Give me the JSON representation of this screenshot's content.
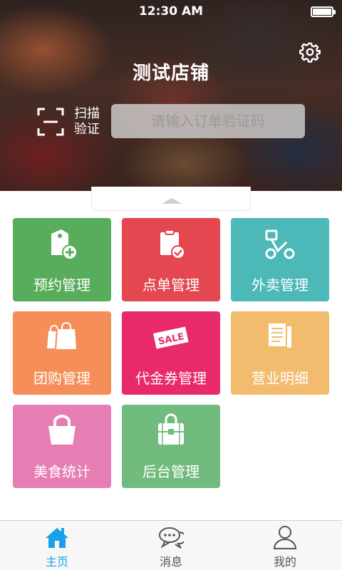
{
  "status_bar": {
    "time": "12:30 AM"
  },
  "header": {
    "shop_name": "测试店铺",
    "settings_icon": "gear-icon",
    "scan": {
      "icon": "scan-frame-icon",
      "line1": "扫描",
      "line2": "验证"
    },
    "verify_input": {
      "placeholder": "请输入订单验证码",
      "value": ""
    },
    "collapse_icon": "triangle-up-icon"
  },
  "tiles": [
    {
      "label": "预约管理",
      "icon": "tag-plus-icon",
      "color": "#58ad5c"
    },
    {
      "label": "点单管理",
      "icon": "clipboard-check-icon",
      "color": "#e4474f"
    },
    {
      "label": "外卖管理",
      "icon": "delivery-scooter-icon",
      "color": "#4cb8b7"
    },
    {
      "label": "团购管理",
      "icon": "shopping-bags-icon",
      "color": "#f58e58"
    },
    {
      "label": "代金券管理",
      "icon": "sale-coupon-icon",
      "color": "#e8296a"
    },
    {
      "label": "营业明细",
      "icon": "documents-icon",
      "color": "#f2bb6d"
    },
    {
      "label": "美食统计",
      "icon": "handbag-icon",
      "color": "#e67eb3"
    },
    {
      "label": "后台管理",
      "icon": "briefcase-lock-icon",
      "color": "#72bb7f"
    }
  ],
  "tab_bar": {
    "active_color": "#1aa0e6",
    "tabs": [
      {
        "label": "主页",
        "icon": "home-icon",
        "active": true
      },
      {
        "label": "消息",
        "icon": "chat-bubbles-icon",
        "active": false
      },
      {
        "label": "我的",
        "icon": "user-icon",
        "active": false
      }
    ]
  }
}
